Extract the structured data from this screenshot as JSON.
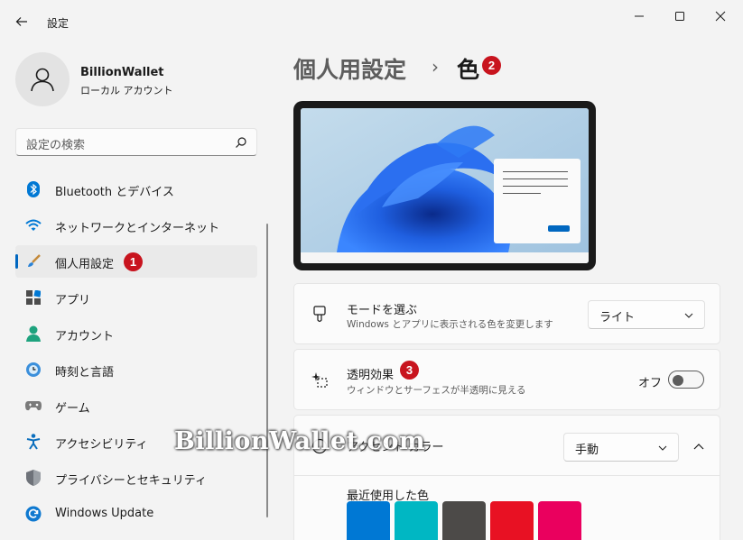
{
  "window": {
    "title": "設定"
  },
  "profile": {
    "name": "BillionWallet",
    "account_type": "ローカル アカウント"
  },
  "search": {
    "placeholder": "設定の検索"
  },
  "sidebar": {
    "items": [
      {
        "label": "Bluetooth とデバイス",
        "icon": "bluetooth-icon"
      },
      {
        "label": "ネットワークとインターネット",
        "icon": "wifi-icon"
      },
      {
        "label": "個人用設定",
        "icon": "brush-icon",
        "active": true
      },
      {
        "label": "アプリ",
        "icon": "apps-icon"
      },
      {
        "label": "アカウント",
        "icon": "person-icon"
      },
      {
        "label": "時刻と言語",
        "icon": "clock-globe-icon"
      },
      {
        "label": "ゲーム",
        "icon": "gamepad-icon"
      },
      {
        "label": "アクセシビリティ",
        "icon": "accessibility-icon"
      },
      {
        "label": "プライバシーとセキュリティ",
        "icon": "shield-icon"
      },
      {
        "label": "Windows Update",
        "icon": "update-icon"
      }
    ]
  },
  "badges": {
    "one": "1",
    "two": "2",
    "three": "3"
  },
  "main": {
    "breadcrumb_parent": "個人用設定",
    "breadcrumb_separator": "›",
    "breadcrumb_current": "色",
    "mode": {
      "title": "モードを選ぶ",
      "subtitle": "Windows とアプリに表示される色を変更します",
      "value": "ライト"
    },
    "transparency": {
      "title": "透明効果",
      "subtitle": "ウィンドウとサーフェスが半透明に見える",
      "state_label": "オフ",
      "enabled": false
    },
    "accent": {
      "title_partial": "アクセント カラー",
      "value": "手動"
    },
    "recent_colors": {
      "label": "最近使用した色",
      "colors": [
        "#0078d4",
        "#00b7c3",
        "#4c4a48",
        "#e81123",
        "#ea005e"
      ]
    }
  },
  "watermark": "BillionWallet.com",
  "colors": {
    "accent": "#0067c0",
    "badge": "#c8141e"
  }
}
